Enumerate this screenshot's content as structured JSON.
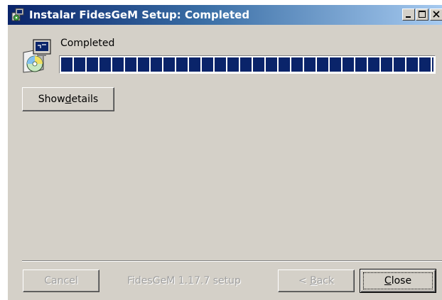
{
  "window": {
    "title": "Instalar FidesGeM Setup: Completed",
    "title_icon": "installer-icon"
  },
  "status": {
    "text": "Completed",
    "progress_percent": 100
  },
  "buttons": {
    "show_details_pre": "Show ",
    "show_details_key": "d",
    "show_details_post": "etails",
    "cancel": "Cancel",
    "back_pre": "< ",
    "back_key": "B",
    "back_post": "ack",
    "close_key": "C",
    "close_post": "lose"
  },
  "footer": {
    "label": "FidesGeM 1.17.7 setup"
  },
  "colors": {
    "titlebar_start": "#0a246a",
    "titlebar_end": "#a6caf0",
    "progress_fill": "#0a246a",
    "face": "#d4d0c8"
  }
}
